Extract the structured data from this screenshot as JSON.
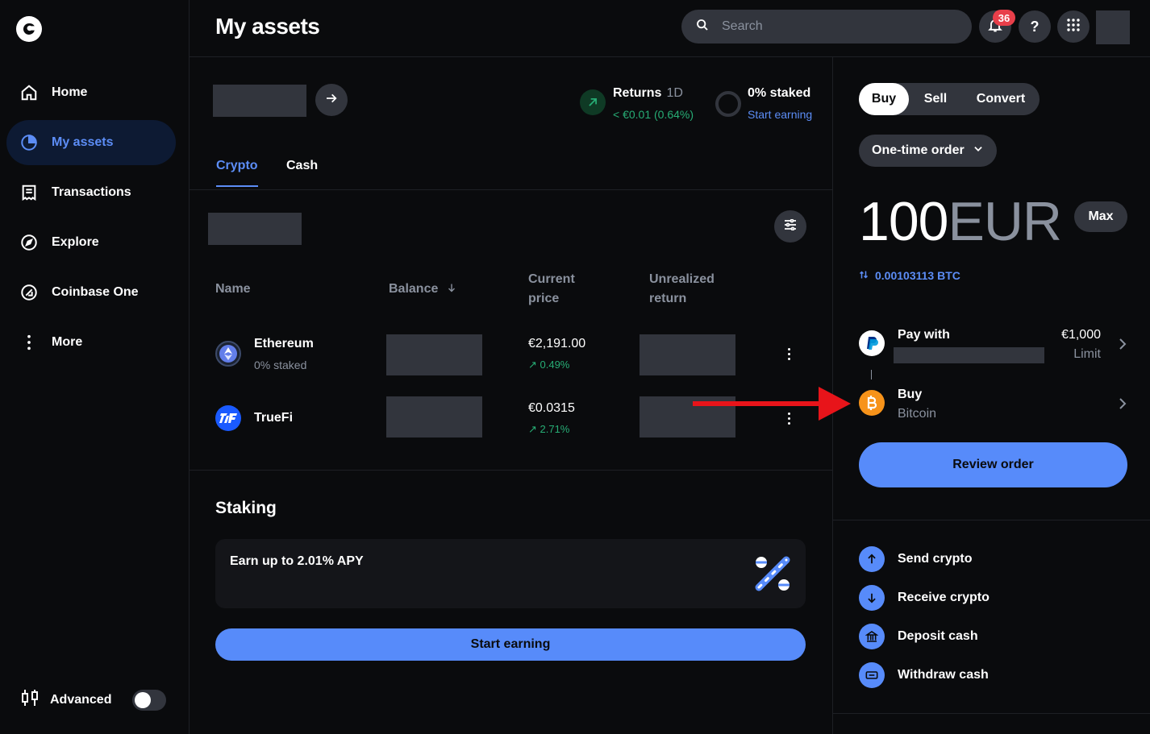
{
  "sidebar": {
    "logo": "coinbase-logo",
    "items": [
      {
        "label": "Home",
        "icon": "home-icon"
      },
      {
        "label": "My assets",
        "icon": "pie-chart-icon",
        "active": true
      },
      {
        "label": "Transactions",
        "icon": "receipt-icon"
      },
      {
        "label": "Explore",
        "icon": "compass-icon"
      },
      {
        "label": "Coinbase One",
        "icon": "coinbase-one-icon"
      },
      {
        "label": "More",
        "icon": "more-vertical-icon"
      }
    ],
    "advanced_label": "Advanced"
  },
  "header": {
    "title": "My assets",
    "search_placeholder": "Search",
    "notification_count": "36",
    "help_label": "?"
  },
  "summary": {
    "returns_label": "Returns",
    "returns_period": "1D",
    "returns_value": "< €0.01 (0.64%)",
    "staked_label": "0% staked",
    "staked_link": "Start earning"
  },
  "tabs": [
    {
      "label": "Crypto",
      "active": true
    },
    {
      "label": "Cash"
    }
  ],
  "table": {
    "columns": {
      "name": "Name",
      "balance": "Balance",
      "price_line1": "Current",
      "price_line2": "price",
      "return_line1": "Unrealized",
      "return_line2": "return"
    },
    "rows": [
      {
        "name": "Ethereum",
        "sub": "0% staked",
        "price": "€2,191.00",
        "change": "↗ 0.49%",
        "icon": "ethereum-icon"
      },
      {
        "name": "TrueFi",
        "sub": "",
        "price": "€0.0315",
        "change": "↗ 2.71%",
        "icon": "truefi-icon"
      }
    ]
  },
  "staking": {
    "title": "Staking",
    "card_text": "Earn up to 2.01% APY",
    "button": "Start earning"
  },
  "trade": {
    "modes": [
      "Buy",
      "Sell",
      "Convert"
    ],
    "order_type": "One-time order",
    "amount": "100",
    "currency": "EUR",
    "max_label": "Max",
    "conversion": "0.00103113 BTC",
    "pay_label": "Pay with",
    "pay_amount": "€1,000",
    "pay_limit": "Limit",
    "buy_label": "Buy",
    "buy_asset": "Bitcoin",
    "review_button": "Review order"
  },
  "actions": [
    {
      "label": "Send crypto",
      "icon": "arrow-up-icon"
    },
    {
      "label": "Receive crypto",
      "icon": "arrow-down-icon"
    },
    {
      "label": "Deposit cash",
      "icon": "bank-icon"
    },
    {
      "label": "Withdraw cash",
      "icon": "cash-icon"
    }
  ],
  "colors": {
    "background": "#0a0b0d",
    "accent": "#578bfa",
    "link": "#5c8df6",
    "positive": "#27ad75",
    "surface": "#32353d",
    "badge": "#e83f4a",
    "annotation_arrow": "#e8141a"
  }
}
